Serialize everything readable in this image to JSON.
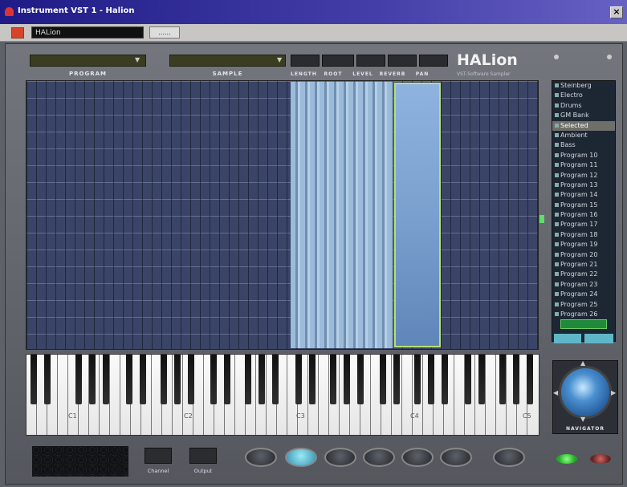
{
  "window": {
    "title": "Instrument VST 1 - Halion",
    "close": "×"
  },
  "toolbar": {
    "program_field": "HALion",
    "small_button": "......"
  },
  "logo": {
    "name": "HALion",
    "tagline": "VST-Software Sampler"
  },
  "program": {
    "label": "PROGRAM",
    "display": ""
  },
  "sample": {
    "label": "SAMPLE",
    "display": ""
  },
  "params": {
    "labels": [
      "LENGTH",
      "ROOT",
      "LEVEL",
      "REVERB",
      "PAN"
    ],
    "values": [
      "",
      "",
      "",
      "",
      "",
      ""
    ]
  },
  "zones": {
    "labels": [
      "",
      "",
      "",
      "",
      "",
      "",
      "",
      "",
      "",
      "",
      ""
    ]
  },
  "grid_rows": [
    "",
    "",
    "",
    "",
    "",
    "",
    "",
    "",
    "",
    "",
    "",
    "",
    "",
    "",
    ""
  ],
  "keyboard": {
    "octaves": [
      "C1",
      "C2",
      "C3",
      "C4",
      "C5"
    ]
  },
  "programs": [
    "Steinberg",
    "Electro",
    "Drums",
    "GM Bank",
    "Selected",
    "Ambient",
    "Bass",
    "Program 10",
    "Program 11",
    "Program 12",
    "Program 13",
    "Program 14",
    "Program 15",
    "Program 16",
    "Program 17",
    "Program 18",
    "Program 19",
    "Program 20",
    "Program 21",
    "Program 22",
    "Program 23",
    "Program 24",
    "Program 25",
    "Program 26"
  ],
  "list_buttons": {
    "primary": "",
    "left": "",
    "right": ""
  },
  "navigator": {
    "label": "NAVIGATOR"
  },
  "midi": {
    "channel": "",
    "channel_label": "Channel",
    "output": "",
    "output_label": "Output"
  },
  "pages": [
    {
      "label": "",
      "active": false
    },
    {
      "label": "",
      "active": true
    },
    {
      "label": "",
      "active": false
    },
    {
      "label": "",
      "active": false
    },
    {
      "label": "",
      "active": false
    },
    {
      "label": "",
      "active": false
    },
    {
      "label": "",
      "active": false
    }
  ],
  "colors": {
    "accent": "#9de9f6",
    "zone": "#7aa0cf",
    "zone_border": "#b8e070",
    "lcd_text": "#c9c04a"
  }
}
